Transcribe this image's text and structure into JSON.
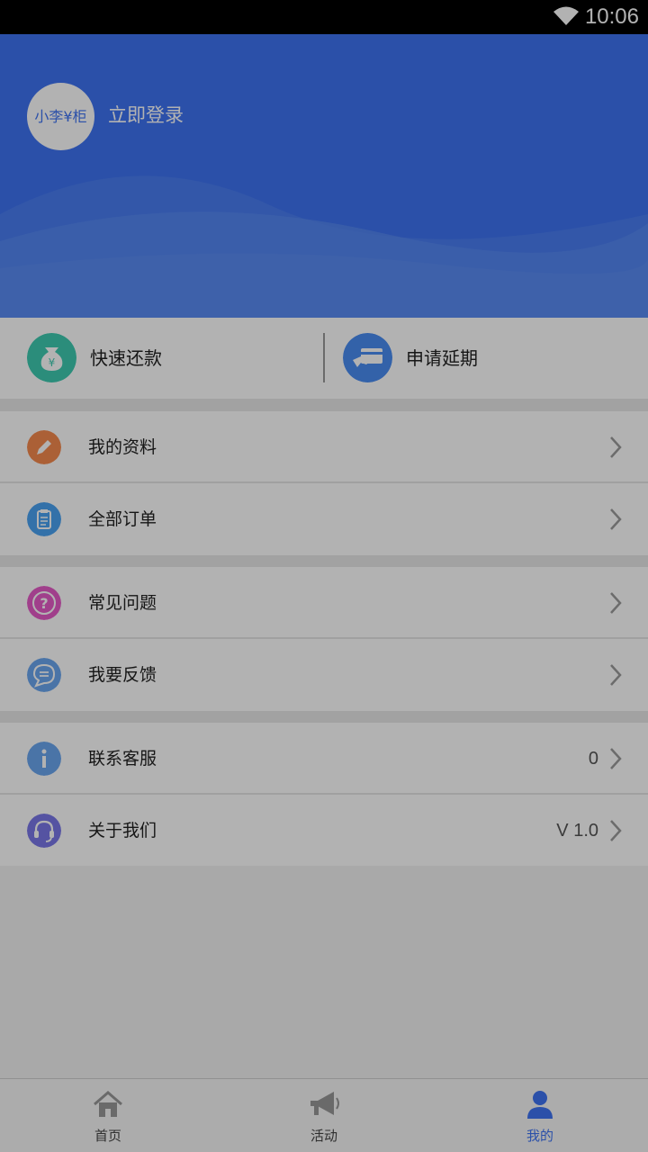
{
  "status_bar": {
    "time": "10:06",
    "icons": [
      "wifi-icon"
    ]
  },
  "header": {
    "avatar_text": "小李¥柜",
    "login_label": "立即登录"
  },
  "quick_actions": [
    {
      "label": "快速还款",
      "icon": "money-bag-icon",
      "color": "#3ecab0"
    },
    {
      "label": "申请延期",
      "icon": "card-hand-icon",
      "color": "#4a8df2"
    }
  ],
  "menu": {
    "profile": {
      "label": "我的资料",
      "icon": "pencil-icon",
      "color": "#f58a4e"
    },
    "orders": {
      "label": "全部订单",
      "icon": "clipboard-icon",
      "color": "#4aa3f2"
    },
    "faq": {
      "label": "常见问题",
      "icon": "question-icon",
      "color": "#e65bc8"
    },
    "feedback": {
      "label": "我要反馈",
      "icon": "chat-icon",
      "color": "#6aa6f0"
    },
    "contact": {
      "label": "联系客服",
      "icon": "info-icon",
      "color": "#6aa6f0",
      "value": "0"
    },
    "about": {
      "label": "关于我们",
      "icon": "headset-icon",
      "color": "#7a78e8",
      "value": "V 1.0"
    }
  },
  "tabs": [
    {
      "label": "首页",
      "icon": "home-icon",
      "active": false
    },
    {
      "label": "活动",
      "icon": "megaphone-icon",
      "active": false
    },
    {
      "label": "我的",
      "icon": "user-icon",
      "active": true
    }
  ],
  "colors": {
    "accent": "#3e73f2",
    "overlay": "rgba(0,0,0,0.30)"
  }
}
